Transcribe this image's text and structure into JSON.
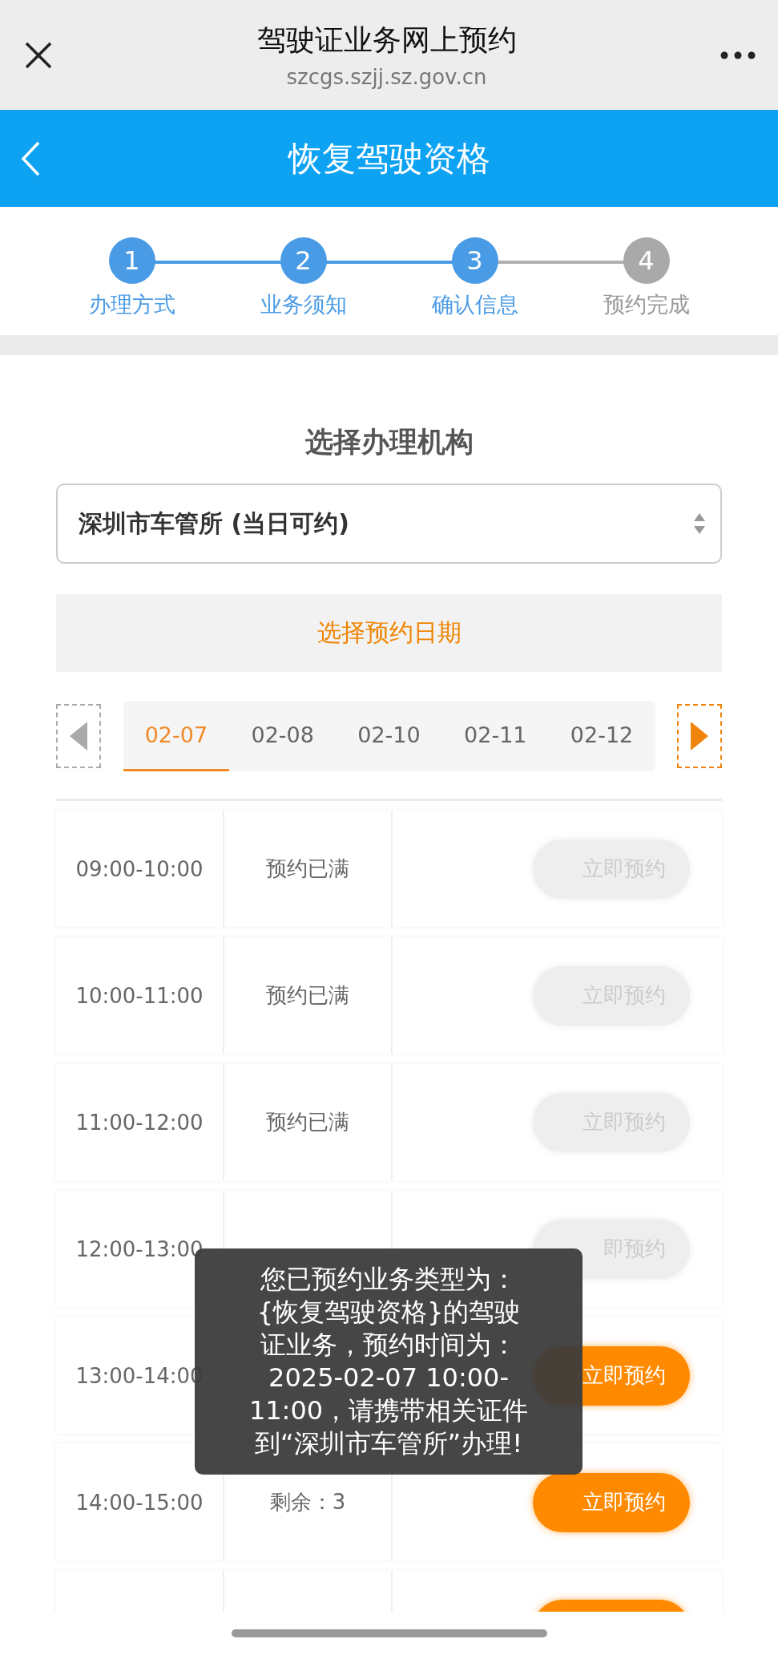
{
  "browser_bar": {
    "title": "驾驶证业务网上预约",
    "url": "szcgs.szjj.sz.gov.cn"
  },
  "header": {
    "title": "恢复驾驶资格"
  },
  "steps": [
    {
      "number": "1",
      "label": "办理方式",
      "done": true
    },
    {
      "number": "2",
      "label": "业务须知",
      "done": true
    },
    {
      "number": "3",
      "label": "确认信息",
      "done": true
    },
    {
      "number": "4",
      "label": "预约完成",
      "done": false
    }
  ],
  "section_title": "选择办理机构",
  "office_select": {
    "value": "深圳市车管所 (当日可约)"
  },
  "date_heading": "选择预约日期",
  "date_nav": {
    "prev_enabled": false,
    "next_enabled": true
  },
  "dates": [
    {
      "label": "02-07",
      "selected": true
    },
    {
      "label": "02-08",
      "selected": false
    },
    {
      "label": "02-10",
      "selected": false
    },
    {
      "label": "02-11",
      "selected": false
    },
    {
      "label": "02-12",
      "selected": false
    }
  ],
  "slots": [
    {
      "time": "09:00-10:00",
      "status": "预约已满",
      "button": "立即预约",
      "disabled": true
    },
    {
      "time": "10:00-11:00",
      "status": "预约已满",
      "button": "立即预约",
      "disabled": true
    },
    {
      "time": "11:00-12:00",
      "status": "预约已满",
      "button": "立即预约",
      "disabled": true
    },
    {
      "time": "12:00-13:00",
      "button": "即预约",
      "disabled": true
    },
    {
      "time": "13:00-14:00",
      "button": "立即预约",
      "disabled": false
    },
    {
      "time": "14:00-15:00",
      "status": "剩余：3",
      "button": "立即预约",
      "disabled": false
    },
    {
      "disabled": false
    }
  ],
  "toast": {
    "message": "您已预约业务类型为：{恢复驾驶资格}的驾驶证业务，预约时间为：2025-02-07 10:00-11:00，请携带相关证件到“深圳市车管所”办理!"
  }
}
